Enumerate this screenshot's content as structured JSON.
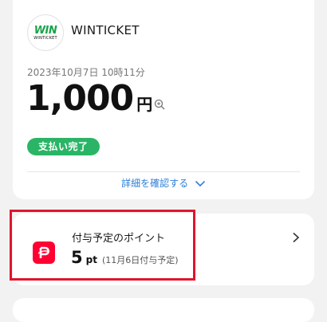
{
  "transaction": {
    "merchant_logo_text": "WIN",
    "merchant_logo_subtext": "WINTICKET",
    "merchant_name": "WINTICKET",
    "datetime": "2023年10月7日 10時11分",
    "amount": "1,000",
    "currency_label": "円",
    "status": "支払い完了",
    "details_link": "詳細を確認する"
  },
  "points": {
    "title": "付与予定のポイント",
    "value": "5",
    "unit": "pt",
    "note": "(11月6日付与予定)"
  },
  "colors": {
    "status_green": "#2ab566",
    "link_blue": "#2f7fd6",
    "paypay_red": "#ff0033",
    "highlight_red": "#e0152b"
  },
  "icons": {
    "zoom": "zoom-in-icon",
    "expand": "chevron-down-icon",
    "navigate": "chevron-right-icon",
    "paypay": "paypay-icon"
  }
}
